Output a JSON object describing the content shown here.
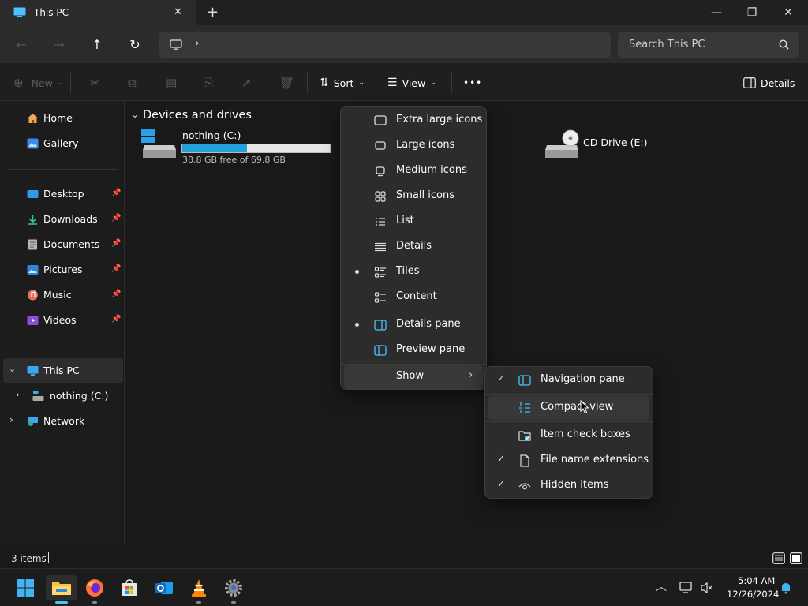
{
  "window": {
    "tab_title": "This PC",
    "new_tab": "+",
    "minimize": "—",
    "maximize": "❐",
    "close": "✕"
  },
  "address": {
    "search_placeholder": "Search This PC"
  },
  "commandbar": {
    "new_label": "New",
    "sort_label": "Sort",
    "view_label": "View",
    "more_label": "•••",
    "details_label": "Details"
  },
  "sidebar": {
    "items": [
      {
        "label": "Home",
        "icon": "home-icon"
      },
      {
        "label": "Gallery",
        "icon": "gallery-icon"
      },
      {
        "label": "Desktop",
        "icon": "desktop-icon"
      },
      {
        "label": "Downloads",
        "icon": "downloads-icon"
      },
      {
        "label": "Documents",
        "icon": "documents-icon"
      },
      {
        "label": "Pictures",
        "icon": "pictures-icon"
      },
      {
        "label": "Music",
        "icon": "music-icon"
      },
      {
        "label": "Videos",
        "icon": "videos-icon"
      },
      {
        "label": "This PC",
        "icon": "this-pc-icon"
      },
      {
        "label": "nothing (C:)",
        "icon": "drive-icon"
      },
      {
        "label": "Network",
        "icon": "network-icon"
      }
    ]
  },
  "content": {
    "group_header": "Devices and drives",
    "drives": [
      {
        "name": "nothing (C:)",
        "free": "38.8 GB free of 69.8 GB",
        "used_fraction": 0.44
      },
      {
        "name": "CD Drive (E:)"
      }
    ]
  },
  "view_menu": {
    "items": [
      {
        "label": "Extra large icons",
        "selected": false
      },
      {
        "label": "Large icons",
        "selected": false
      },
      {
        "label": "Medium icons",
        "selected": false
      },
      {
        "label": "Small icons",
        "selected": false
      },
      {
        "label": "List",
        "selected": false
      },
      {
        "label": "Details",
        "selected": false
      },
      {
        "label": "Tiles",
        "selected": true
      },
      {
        "label": "Content",
        "selected": false
      }
    ],
    "panes": [
      {
        "label": "Details pane",
        "selected": true
      },
      {
        "label": "Preview pane",
        "selected": false
      }
    ],
    "show_label": "Show"
  },
  "show_submenu": {
    "items": [
      {
        "label": "Navigation pane",
        "checked": true
      },
      {
        "label": "Compact view",
        "checked": false
      },
      {
        "label": "Item check boxes",
        "checked": false
      },
      {
        "label": "File name extensions",
        "checked": true
      },
      {
        "label": "Hidden items",
        "checked": true
      }
    ]
  },
  "status": {
    "item_count": "3 items"
  },
  "taskbar": {
    "time": "5:04 AM",
    "date": "12/26/2024"
  },
  "colors": {
    "accent": "#4cc2ff",
    "progress_fill": "#26a0da",
    "progress_track": "#e6e6e6"
  }
}
